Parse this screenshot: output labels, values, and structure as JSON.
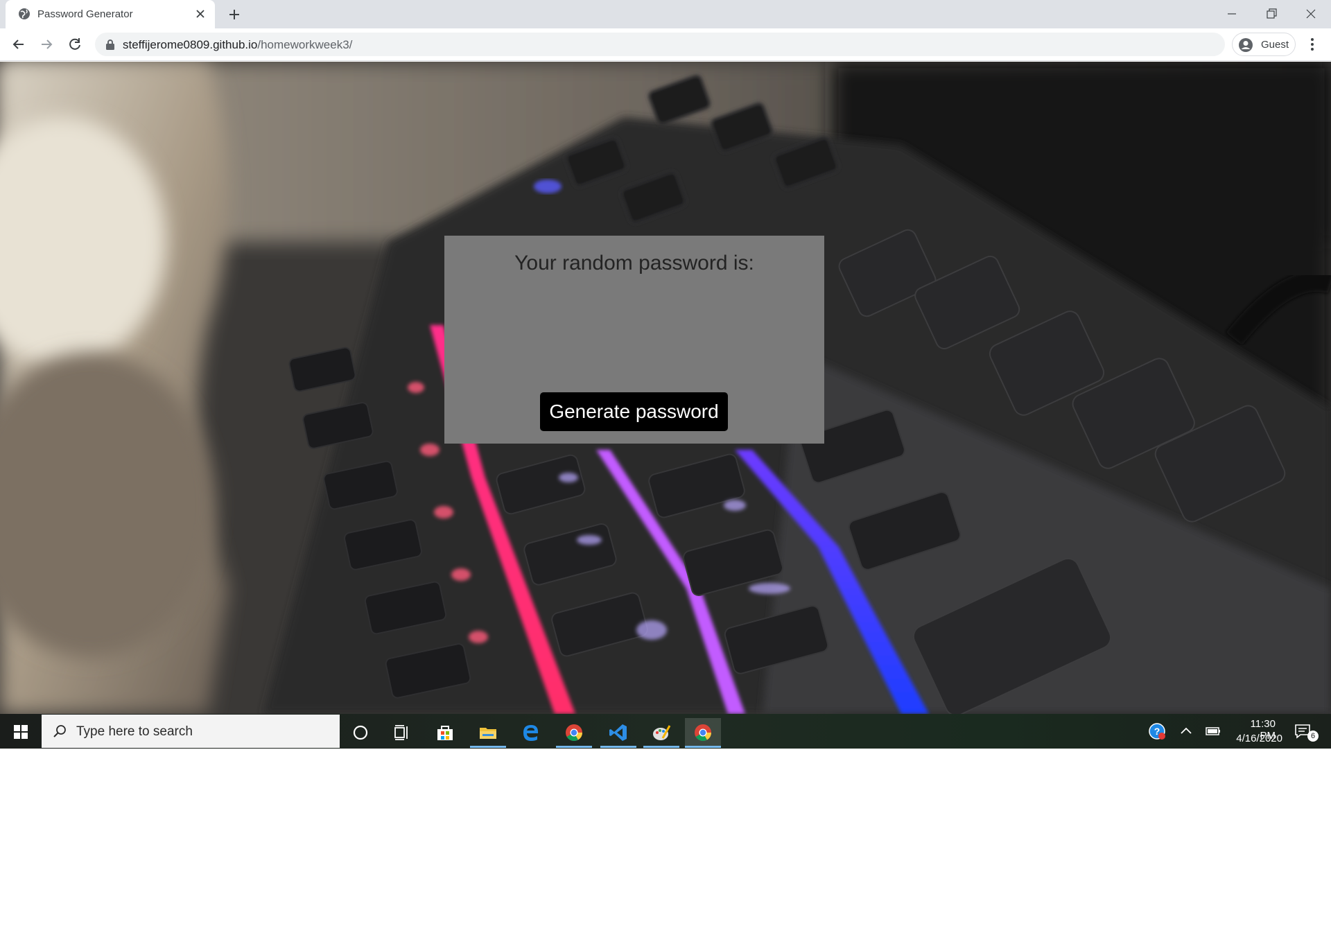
{
  "browser": {
    "tab_title": "Password Generator",
    "url_host": "steffijerome0809.github.io",
    "url_path": "/homeworkweek3/",
    "profile_label": "Guest"
  },
  "page": {
    "heading": "Your random password is:",
    "password_value": "",
    "generate_button": "Generate password"
  },
  "taskbar": {
    "search_placeholder": "Type here to search",
    "time": "11:30 PM",
    "date": "4/16/2020",
    "notification_count": "6",
    "pinned_apps": [
      "cortana",
      "task-view",
      "microsoft-store",
      "file-explorer",
      "edge",
      "chrome",
      "vscode",
      "paint",
      "chrome-active"
    ]
  },
  "colors": {
    "card_bg": "#7a7a7a",
    "button_bg": "#000000",
    "button_text": "#ffffff",
    "chrome_frame": "#dee1e6"
  }
}
